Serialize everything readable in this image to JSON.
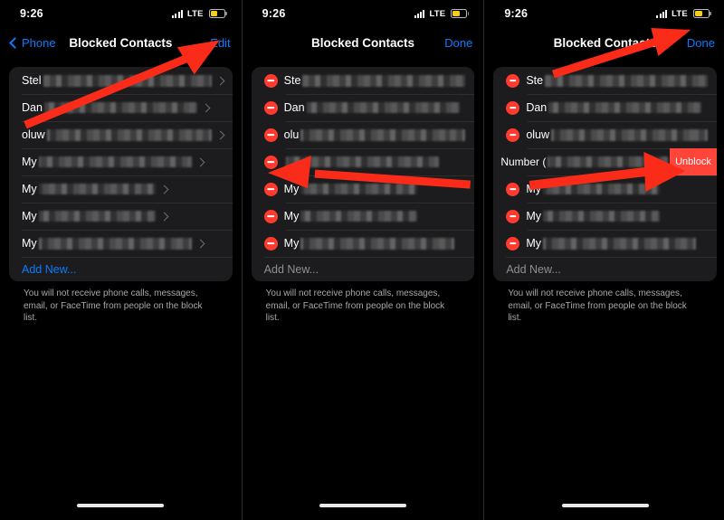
{
  "meta": {
    "accent_blue": "#0a7cff",
    "destructive_red": "#ff3b30",
    "annotation_red": "#fb2b1a",
    "card_bg": "#1c1c1e",
    "screen_bg": "#000000",
    "battery_yellow": "#f5cd1e"
  },
  "status_bar": {
    "time": "9:26",
    "carrier_tech": "LTE",
    "signal_icon": "cellular-bars-icon",
    "battery_icon": "battery-low-power-icon"
  },
  "panels": [
    {
      "id": "panel-browse",
      "nav": {
        "back_label": "Phone",
        "back_icon": "chevron-left-icon",
        "title": "Blocked Contacts",
        "action_label": "Edit",
        "action_state": "edit"
      },
      "rows": [
        {
          "name": "Stel",
          "redacted": true,
          "accessory": "chevron-right-icon"
        },
        {
          "name": "Dan",
          "redacted": true,
          "accessory": "chevron-right-icon"
        },
        {
          "name": "oluw",
          "redacted": true,
          "accessory": "chevron-right-icon"
        },
        {
          "name": "My",
          "redacted": true,
          "accessory": "chevron-right-icon"
        },
        {
          "name": "My",
          "redacted": true,
          "accessory": "chevron-right-icon"
        },
        {
          "name": "My",
          "redacted": true,
          "accessory": "chevron-right-icon"
        },
        {
          "name": "My",
          "redacted": true,
          "accessory": "chevron-right-icon"
        }
      ],
      "add_new_label": "Add New...",
      "add_new_enabled": true,
      "footnote": "You will not receive phone calls, messages, email, or FaceTime from people on the block list.",
      "annotation": {
        "type": "arrow",
        "points_to": "Edit",
        "direction": "up-right"
      }
    },
    {
      "id": "panel-edit-mode",
      "nav": {
        "back_label": "",
        "title": "Blocked Contacts",
        "action_label": "Done",
        "action_state": "done"
      },
      "rows": [
        {
          "name": "Ste",
          "redacted": true,
          "delete_icon": "minus-circle-icon"
        },
        {
          "name": "Dan",
          "redacted": true,
          "delete_icon": "minus-circle-icon"
        },
        {
          "name": "olu",
          "redacted": true,
          "delete_icon": "minus-circle-icon"
        },
        {
          "name": "",
          "redacted": true,
          "delete_icon": "minus-circle-icon"
        },
        {
          "name": "My",
          "redacted": true,
          "delete_icon": "minus-circle-icon"
        },
        {
          "name": "My",
          "redacted": true,
          "delete_icon": "minus-circle-icon"
        },
        {
          "name": "My",
          "redacted": true,
          "delete_icon": "minus-circle-icon"
        }
      ],
      "add_new_label": "Add New...",
      "add_new_enabled": false,
      "footnote": "You will not receive phone calls, messages, email, or FaceTime from people on the block list.",
      "annotation": {
        "type": "arrow",
        "points_to": "minus-circle-icon row 4",
        "direction": "left"
      }
    },
    {
      "id": "panel-swipe-unblock",
      "nav": {
        "back_label": "",
        "title": "Blocked Contacts",
        "action_label": "Done",
        "action_state": "done"
      },
      "rows": [
        {
          "name": "Ste",
          "redacted": true,
          "delete_icon": "minus-circle-icon",
          "swiped": false
        },
        {
          "name": "Dan",
          "redacted": true,
          "delete_icon": "minus-circle-icon",
          "swiped": false
        },
        {
          "name": "oluw",
          "redacted": true,
          "delete_icon": "minus-circle-icon",
          "swiped": false
        },
        {
          "name": "Number (",
          "redacted": true,
          "delete_icon": "",
          "swiped": true,
          "swipe_action_label": "Unblock"
        },
        {
          "name": "My",
          "redacted": true,
          "delete_icon": "minus-circle-icon",
          "swiped": false
        },
        {
          "name": "My",
          "redacted": true,
          "delete_icon": "minus-circle-icon",
          "swiped": false
        },
        {
          "name": "My",
          "redacted": true,
          "delete_icon": "minus-circle-icon",
          "swiped": false
        }
      ],
      "add_new_label": "Add New...",
      "add_new_enabled": false,
      "footnote": "You will not receive phone calls, messages, email, or FaceTime from people on the block list.",
      "annotations": [
        {
          "type": "arrow",
          "points_to": "Done",
          "direction": "up-right"
        },
        {
          "type": "arrow",
          "points_to": "Unblock",
          "direction": "right"
        }
      ]
    }
  ]
}
